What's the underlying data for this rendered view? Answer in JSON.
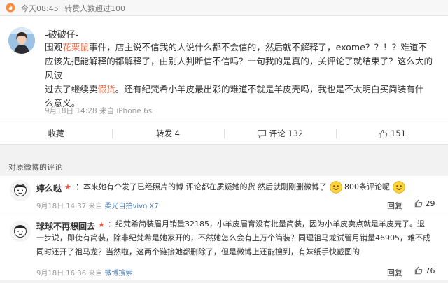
{
  "header": {
    "time": "今天08:45",
    "repost_count_text": "转赞人数超过100"
  },
  "post": {
    "author": "-破破仔-",
    "lines": [
      {
        "pre": "围观",
        "highlight": "花栗鼠",
        "post": "事件，店主说不信我的人说什么都不会信的，然后就不解释了，exome？？！？难道不"
      },
      {
        "pre": "应该先把能解释的都解释了，由别人判断信不信吗？一句我的是真的，关评论了就结束了？这么大的风波",
        "highlight": "",
        "post": ""
      },
      {
        "pre": "过去了继续卖",
        "highlight": "假货",
        "post": "。还有纪梵希小羊皮最出彩的难道不就是羊皮壳吗，我也是不太明白买简装有什"
      },
      {
        "pre": "么意义。",
        "highlight": "",
        "post": ""
      }
    ],
    "meta": "9月18日 14:28 来自 iPhone 6s"
  },
  "actions": {
    "favorite": "收藏",
    "repost": "转发 4",
    "comment": "评论 132",
    "like": "151"
  },
  "section_title": "对原微博的评论",
  "comments": [
    {
      "name": "婷么哒",
      "text_a": "：本来她有个发了已经照片的博 评论都在质疑她的货 然后就刚刚删微博了",
      "text_b": "800条评论呢",
      "meta_time": "9月18日 14:37 来自",
      "meta_via": "柔光自拍vivo X7",
      "reply": "回复",
      "likes": "29"
    },
    {
      "name": "球球不再想回去",
      "lines": [
        "：纪梵希简装眉月销量32185，小羊皮眉育没有批量简装，因为小羊皮卖点就是羊皮壳子。退",
        "一步说，即使有简装，除非纪梵希是她家开的，不然她怎么会有上万个简装？同理祖马龙试管月销量46905，难不成",
        "同时还开了祖马龙？当然啦，这两个链接她都删除了，但是微博上还能搜到，有妹纸手快截图的"
      ],
      "meta_time": "9月18日 16:36 来自",
      "meta_via": "微博搜索",
      "reply": "回复",
      "likes": "76"
    }
  ],
  "colors": {
    "accent": "#eb7350",
    "link": "#507daf",
    "verified": "#e8543f"
  }
}
